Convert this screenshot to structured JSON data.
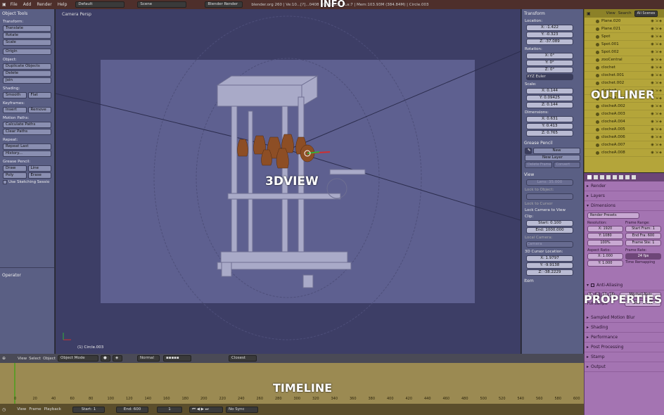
{
  "info_bar": {
    "menus": [
      "File",
      "Add",
      "Render",
      "Help"
    ],
    "screen_layout": "Default",
    "scene": "Scene",
    "engine": "Blender Render",
    "stats": "blender.org 260 | Ve:10...[?]...0408 | Ob:1-136 | La:7 | Mem:103.93M (384.84M) | Circle.003",
    "overlay_label": "INFO"
  },
  "tool_shelf": {
    "title": "Object Tools",
    "transform_label": "Transform:",
    "translate": "Translate",
    "rotate": "Rotate",
    "scale": "Scale",
    "origin": "Origin",
    "object_label": "Object:",
    "duplicate": "Duplicate Objects",
    "delete": "Delete",
    "join": "Join",
    "shading_label": "Shading:",
    "smooth": "Smooth",
    "flat": "Flat",
    "keyframes_label": "Keyframes:",
    "insert": "Insert",
    "remove": "Remove",
    "motion_paths_label": "Motion Paths:",
    "calc_paths": "Calculate Paths",
    "clear_paths": "Clear Paths",
    "repeat_label": "Repeat:",
    "repeat_last": "Repeat Last",
    "history": "History...",
    "grease_label": "Grease Pencil:",
    "draw": "Draw",
    "line": "Line",
    "poly": "Poly",
    "erase": "Erase",
    "sketch_session": "Use Sketching Sessio",
    "operator": "Operator"
  },
  "viewport": {
    "label": "Camera Persp",
    "overlay_label": "3DVIEW",
    "object_label": "(1) Circle.003"
  },
  "n_panel": {
    "transform_title": "Transform",
    "location_label": "Location:",
    "loc_x": "X: -1.422",
    "loc_y": "Y: -0.323",
    "loc_z": "Z: -37.089",
    "rotation_label": "Rotation:",
    "rot_x": "X: 0°",
    "rot_y": "Y: 0°",
    "rot_z": "Z: 0°",
    "rot_mode": "XYZ Euler",
    "scale_label": "Scale:",
    "scl_x": "X: 0.144",
    "scl_y": "Y: 0.09425",
    "scl_z": "Z: 0.144",
    "dimensions_label": "Dimensions:",
    "dim_x": "X: 0.631",
    "dim_y": "Y: 0.413",
    "dim_z": "Z: 0.765",
    "grease_title": "Grease Pencil",
    "gp_new": "New",
    "gp_new_layer": "New Layer",
    "gp_delete_frame": "Delete Frame",
    "gp_convert": "Convert",
    "view_title": "View",
    "lens": "Lens: 35.000",
    "lock_object_label": "Lock to Object:",
    "lock_cursor": "Lock to Cursor",
    "lock_camera": "Lock Camera to View",
    "clip_label": "Clip:",
    "clip_start": "Start: 0.100",
    "clip_end": "End: 1000.000",
    "local_camera_label": "Local Camera:",
    "local_camera": "Camera",
    "cursor_label": "3D Cursor Location:",
    "cur_x": "X: 1.9797",
    "cur_y": "Y: -9.9138",
    "cur_z": "Z: -38.2229",
    "item_title": "Item"
  },
  "outliner": {
    "overlay_label": "OUTLINER",
    "view": "View",
    "search": "Search",
    "scenes": "All Scenes",
    "items": [
      "Plane.020",
      "Plane.021",
      "Spot",
      "Spot.001",
      "Spot.002",
      "zooCentral",
      "clochet",
      "clochet.001",
      "clochet.002",
      "clocheA",
      "clocheA.001",
      "clocheA.002",
      "clocheA.003",
      "clocheA.004",
      "clocheA.005",
      "clocheA.006",
      "clocheA.007",
      "clocheA.008"
    ]
  },
  "properties": {
    "overlay_label": "PROPERTIES",
    "render": "Render",
    "layers": "Layers",
    "dimensions": "Dimensions",
    "render_presets": "Render Presets",
    "resolution_label": "Resolution:",
    "res_x": "X: 1920",
    "res_y": "Y: 1080",
    "res_pct": "100%",
    "frame_range_label": "Frame Range:",
    "start_frame": "Start Fram: 1",
    "end_frame": "End Fra: 600",
    "frame_step": "Frame Ste: 1",
    "aspect_label": "Aspect Ratio:",
    "asp_x": "X: 1.000",
    "asp_y": "Y: 1.000",
    "frame_rate_label": "Frame Rate:",
    "fps": "24 fps",
    "time_remap": "Time Remapping",
    "anti_aliasing": "Anti-Aliasing",
    "aa_samples": [
      "5",
      "8",
      "11",
      "16"
    ],
    "aa_filter": "Mitchell-Netr",
    "full_sample": "Full Sample",
    "aa_size": "Size: 1.000",
    "motion_blur": "Sampled Motion Blur",
    "shading": "Shading",
    "performance": "Performance",
    "post_processing": "Post Processing",
    "stamp": "Stamp",
    "output": "Output"
  },
  "view3d_header": {
    "view": "View",
    "select": "Select",
    "object": "Object",
    "mode": "Object Mode",
    "pivot": "Normal",
    "snap": "Closest"
  },
  "timeline": {
    "overlay_label": "TIMELINE",
    "ticks": [
      "0",
      "20",
      "40",
      "60",
      "80",
      "100",
      "120",
      "140",
      "160",
      "180",
      "200",
      "220",
      "240",
      "260",
      "280",
      "300",
      "320",
      "340",
      "360",
      "380",
      "400",
      "420",
      "440",
      "460",
      "480",
      "500",
      "520",
      "540",
      "560",
      "580",
      "600"
    ],
    "view": "View",
    "frame": "Frame",
    "playback": "Playback",
    "start": "Start: 1",
    "end": "End: 600",
    "current": "1",
    "sync": "No Sync"
  }
}
